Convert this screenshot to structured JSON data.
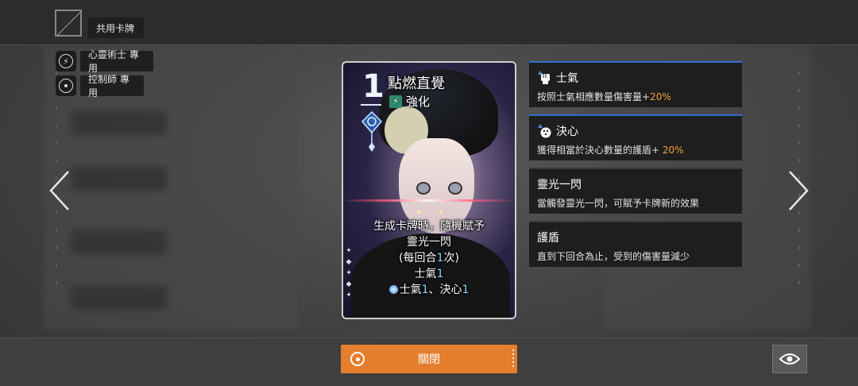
{
  "header": {
    "common_card_tag": "共用卡牌"
  },
  "class_tags": [
    {
      "label": "心靈術士 專用",
      "icon": "lightning-ring-icon"
    },
    {
      "label": "控制師 專用",
      "icon": "target-ring-icon"
    }
  ],
  "card": {
    "cost": "1",
    "name": "點燃直覺",
    "type": "強化",
    "desc": {
      "line1": "生成卡牌時，隨機賦予",
      "line2": "靈光一閃",
      "line3_pre": "(每回合",
      "line3_num": "1",
      "line3_post": "次)",
      "line4_pre": "士氣",
      "line4_num": "1",
      "line5_a": "士氣",
      "line5_a_num": "1",
      "line5_sep": "、決心",
      "line5_b_num": "1"
    }
  },
  "keywords": [
    {
      "title": "士氣",
      "desc_pre": "按照士氣相應數量傷害量+",
      "desc_hl": "20%",
      "icon": "fist-icon"
    },
    {
      "title": "決心",
      "desc_pre": "獲得相當於決心數量的護盾+ ",
      "desc_hl": "20%",
      "icon": "dice-icon"
    },
    {
      "title": "靈光一閃",
      "desc_pre": "當觸發靈光一閃，可賦予卡牌新的效果",
      "desc_hl": ""
    },
    {
      "title": "護盾",
      "desc_pre": "直到下回合為止，受到的傷害量減少",
      "desc_hl": ""
    }
  ],
  "footer": {
    "close_label": "關閉"
  },
  "colors": {
    "accent_orange": "#e57e2e",
    "highlight_orange": "#f0a23d",
    "highlight_blue": "#8fd6ff",
    "active_border": "#2f6fd0"
  }
}
